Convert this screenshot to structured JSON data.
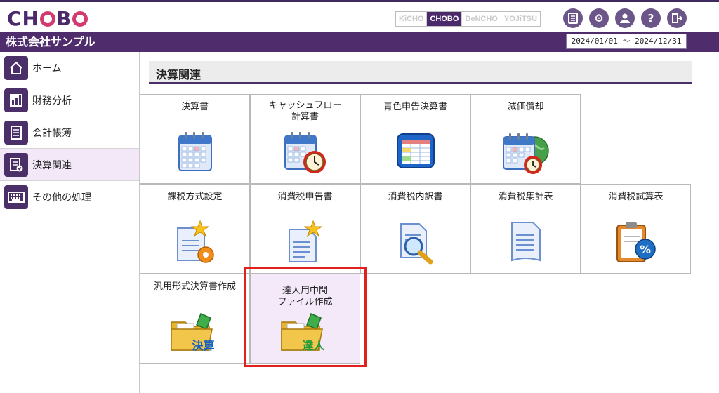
{
  "app": {
    "logo": "CHOBO",
    "company": "株式会社サンプル",
    "period": "2024/01/01 ～ 2024/12/31"
  },
  "switcher": [
    "KiCHO",
    "CHOBO",
    "DeNCHO",
    "YOJiTSU"
  ],
  "top_icons": [
    "document-icon",
    "settings-icon",
    "user-settings-icon",
    "help-icon",
    "logout-icon"
  ],
  "sidebar": {
    "items": [
      {
        "label": "ホーム",
        "icon": "home-icon",
        "active": false
      },
      {
        "label": "財務分析",
        "icon": "bar-chart-icon",
        "active": false
      },
      {
        "label": "会計帳簿",
        "icon": "ledger-icon",
        "active": false
      },
      {
        "label": "決算関連",
        "icon": "settlement-icon",
        "active": true
      },
      {
        "label": "その他の処理",
        "icon": "keyboard-icon",
        "active": false
      }
    ]
  },
  "main": {
    "title": "決算関連",
    "tiles": [
      {
        "label": "決算書",
        "icon": "calendar-icon"
      },
      {
        "label": "キャッシュフロー\n計算書",
        "icon": "calendar-clock-icon"
      },
      {
        "label": "青色申告決算書",
        "icon": "blue-sheet-icon"
      },
      {
        "label": "減価償却",
        "icon": "calendar-globe-clock-icon"
      },
      {
        "label": "課税方式設定",
        "icon": "document-gear-star-icon"
      },
      {
        "label": "消費税申告書",
        "icon": "document-star-icon"
      },
      {
        "label": "消費税内訳書",
        "icon": "document-magnifier-icon"
      },
      {
        "label": "消費税集計表",
        "icon": "document-lines-icon"
      },
      {
        "label": "消費税試算表",
        "icon": "clipboard-percent-icon"
      },
      {
        "label": "汎用形式決算書作成",
        "icon": "folder-kessan-icon",
        "badge": "決算"
      },
      {
        "label": "達人用中間\nファイル作成",
        "icon": "folder-tatsujin-icon",
        "badge": "達人"
      }
    ]
  },
  "colors": {
    "brand": "#4f2d6d",
    "accent": "#d23b70",
    "highlight": "#f3e9f9",
    "frame": "#e0211d"
  }
}
